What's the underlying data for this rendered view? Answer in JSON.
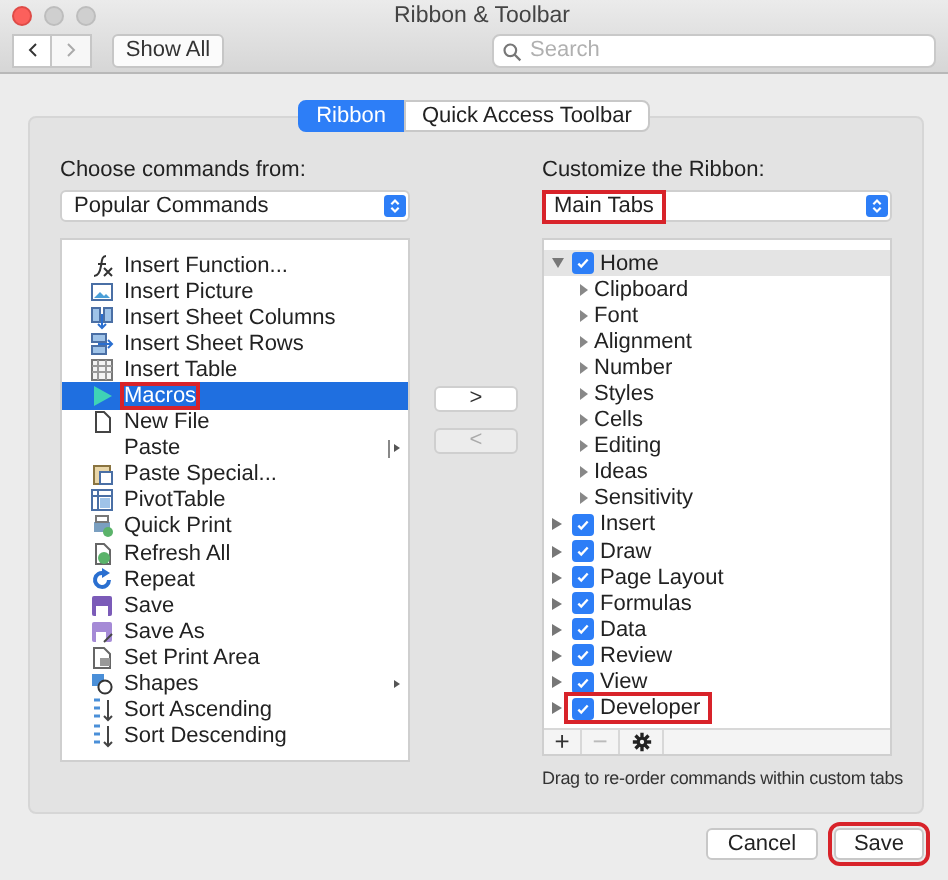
{
  "window": {
    "title": "Ribbon & Toolbar"
  },
  "toolbar": {
    "show_all": "Show All",
    "search": {
      "placeholder": "Search"
    }
  },
  "tabs": [
    {
      "label": "Ribbon",
      "selected": true
    },
    {
      "label": "Quick Access Toolbar",
      "selected": false
    }
  ],
  "commands": {
    "label": "Choose commands from:",
    "dropdown": {
      "value": "Popular Commands",
      "callout": false
    },
    "items": [
      {
        "label": "Insert Function...",
        "selected": false,
        "callout": false,
        "split_menu": false,
        "submenu": false
      },
      {
        "label": "Insert Picture",
        "selected": false,
        "callout": false,
        "split_menu": false,
        "submenu": false
      },
      {
        "label": "Insert Sheet Columns",
        "selected": false,
        "callout": false,
        "split_menu": false,
        "submenu": false
      },
      {
        "label": "Insert Sheet Rows",
        "selected": false,
        "callout": false,
        "split_menu": false,
        "submenu": false
      },
      {
        "label": "Insert Table",
        "selected": false,
        "callout": false,
        "split_menu": false,
        "submenu": false
      },
      {
        "label": "Macros",
        "selected": true,
        "callout": true,
        "split_menu": false,
        "submenu": false
      },
      {
        "label": "New File",
        "selected": false,
        "callout": false,
        "split_menu": false,
        "submenu": false
      },
      {
        "label": "Paste",
        "selected": false,
        "callout": false,
        "split_menu": true,
        "submenu": false
      },
      {
        "label": "Paste Special...",
        "selected": false,
        "callout": false,
        "split_menu": false,
        "submenu": false
      },
      {
        "label": "PivotTable",
        "selected": false,
        "callout": false,
        "split_menu": false,
        "submenu": false
      },
      {
        "label": "Quick Print",
        "selected": false,
        "callout": false,
        "split_menu": false,
        "submenu": false
      },
      {
        "label": "Refresh All",
        "selected": false,
        "callout": false,
        "split_menu": false,
        "submenu": false
      },
      {
        "label": "Repeat",
        "selected": false,
        "callout": false,
        "split_menu": false,
        "submenu": false
      },
      {
        "label": "Save",
        "selected": false,
        "callout": false,
        "split_menu": false,
        "submenu": false
      },
      {
        "label": "Save As",
        "selected": false,
        "callout": false,
        "split_menu": false,
        "submenu": false
      },
      {
        "label": "Set Print Area",
        "selected": false,
        "callout": false,
        "split_menu": false,
        "submenu": false
      },
      {
        "label": "Shapes",
        "selected": false,
        "callout": false,
        "split_menu": false,
        "submenu": true
      },
      {
        "label": "Sort Ascending",
        "selected": false,
        "callout": false,
        "split_menu": false,
        "submenu": false
      },
      {
        "label": "Sort Descending",
        "selected": false,
        "callout": false,
        "split_menu": false,
        "submenu": false
      }
    ]
  },
  "move_buttons": [
    {
      "label": ">",
      "disabled": false
    },
    {
      "label": "<",
      "disabled": true
    }
  ],
  "ribbon": {
    "label": "Customize the Ribbon:",
    "dropdown": {
      "value": "Main Tabs",
      "callout": true
    },
    "tabs": [
      {
        "label": "Home",
        "checked": true,
        "expanded": true,
        "selected": true,
        "callout": false,
        "children": [
          {
            "label": "Clipboard",
            "expanded": false
          },
          {
            "label": "Font",
            "expanded": false
          },
          {
            "label": "Alignment",
            "expanded": false
          },
          {
            "label": "Number",
            "expanded": false
          },
          {
            "label": "Styles",
            "expanded": false
          },
          {
            "label": "Cells",
            "expanded": false
          },
          {
            "label": "Editing",
            "expanded": false
          },
          {
            "label": "Ideas",
            "expanded": false
          },
          {
            "label": "Sensitivity",
            "expanded": false
          }
        ]
      },
      {
        "label": "Insert",
        "checked": true,
        "expanded": false,
        "selected": false,
        "callout": false
      },
      {
        "label": "Draw",
        "checked": true,
        "expanded": false,
        "selected": false,
        "callout": false
      },
      {
        "label": "Page Layout",
        "checked": true,
        "expanded": false,
        "selected": false,
        "callout": false
      },
      {
        "label": "Formulas",
        "checked": true,
        "expanded": false,
        "selected": false,
        "callout": false
      },
      {
        "label": "Data",
        "checked": true,
        "expanded": false,
        "selected": false,
        "callout": false
      },
      {
        "label": "Review",
        "checked": true,
        "expanded": false,
        "selected": false,
        "callout": false
      },
      {
        "label": "View",
        "checked": true,
        "expanded": false,
        "selected": false,
        "callout": false
      },
      {
        "label": "Developer",
        "checked": true,
        "expanded": false,
        "selected": false,
        "callout": true
      }
    ],
    "tools": [
      {
        "label": "+",
        "disabled": false
      },
      {
        "label": "−",
        "disabled": true
      }
    ],
    "hint": "Drag to re-order commands within custom tabs"
  },
  "buttons": [
    {
      "label": "Cancel",
      "callout": false
    },
    {
      "label": "Save",
      "callout": true
    }
  ]
}
